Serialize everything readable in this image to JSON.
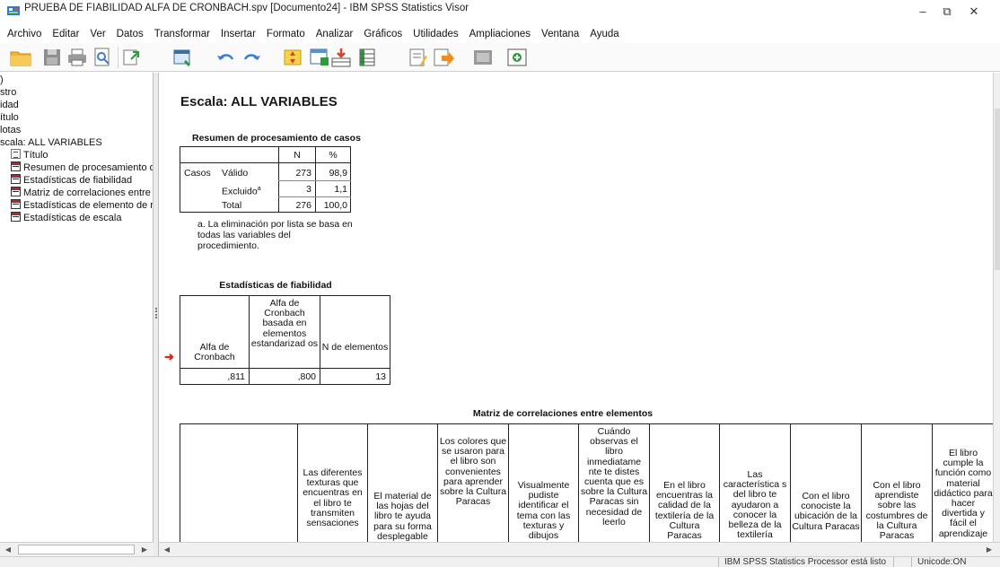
{
  "window": {
    "title": "PRUEBA DE FIABILIDAD ALFA DE CRONBACH.spv [Documento24] - IBM SPSS Statistics Visor",
    "minimize": "–",
    "maximize": "⧉",
    "close": "✕"
  },
  "menu": [
    "Archivo",
    "Editar",
    "Ver",
    "Datos",
    "Transformar",
    "Insertar",
    "Formato",
    "Analizar",
    "Gráficos",
    "Utilidades",
    "Ampliaciones",
    "Ventana",
    "Ayuda"
  ],
  "toolbar_icons": [
    "open-icon",
    "save-icon",
    "print-icon",
    "print-preview-icon",
    "export-icon",
    "recall-dialog-icon",
    "undo-icon",
    "redo-icon",
    "goto-data-icon",
    "goto-case-icon",
    "goto-variable-icon",
    "variables-icon",
    "insert-text-icon",
    "insert-heading-icon",
    "designate-window-icon",
    "show-all-icon"
  ],
  "outline": [
    {
      "label": ")",
      "icon": ""
    },
    {
      "label": "stro",
      "icon": ""
    },
    {
      "label": "idad",
      "icon": ""
    },
    {
      "label": "ítulo",
      "icon": ""
    },
    {
      "label": "lotas",
      "icon": ""
    },
    {
      "label": "scala: ALL VARIABLES",
      "icon": ""
    },
    {
      "label": "Título",
      "icon": "title"
    },
    {
      "label": "Resumen de procesamiento de",
      "icon": "table"
    },
    {
      "label": "Estadísticas de fiabilidad",
      "icon": "table"
    },
    {
      "label": "Matriz de correlaciones entre ele",
      "icon": "table"
    },
    {
      "label": "Estadísticas de elemento de res",
      "icon": "table"
    },
    {
      "label": "Estadísticas de escala",
      "icon": "table"
    }
  ],
  "scale_title": "Escala: ALL VARIABLES",
  "case_summary": {
    "title": "Resumen de procesamiento de casos",
    "headers": [
      "N",
      "%"
    ],
    "row_group": "Casos",
    "rows": [
      {
        "label": "Válido",
        "n": "273",
        "pct": "98,9"
      },
      {
        "label": "Excluido",
        "sup": "a",
        "n": "3",
        "pct": "1,1"
      },
      {
        "label": "Total",
        "n": "276",
        "pct": "100,0"
      }
    ],
    "footnote": "a. La eliminación por lista se basa en todas las variables del procedimiento."
  },
  "reliability": {
    "title": "Estadísticas de fiabilidad",
    "headers": [
      "Alfa de Cronbach",
      "Alfa de Cronbach basada en elementos estandarizad os",
      "N de elementos"
    ],
    "values": [
      ",811",
      ",800",
      "13"
    ]
  },
  "correlation": {
    "title": "Matriz de correlaciones entre elementos",
    "columns": [
      "Las diferentes texturas que encuentras en el libro te transmiten sensaciones",
      "El material de las hojas del libro te ayuda para su forma desplegable",
      "Los colores que se usaron para el libro son convenientes para aprender sobre la Cultura Paracas",
      "Visualmente pudiste identificar el tema con las texturas y dibujos",
      "Cuándo observas el libro inmediatame nte te distes cuenta que es sobre la Cultura Paracas sin necesidad de leerlo",
      "En el libro encuentras la calidad de la textilería de la Cultura Paracas",
      "Las característica s del libro te ayudaron a conocer la belleza de la textilería",
      "Con el libro conociste la ubicación de la Cultura Paracas",
      "Con el libro aprendiste sobre las costumbres de la Cultura Paracas",
      "El libro cumple la función como material didáctico para hacer divertida y fácil el aprendizaje"
    ]
  },
  "status": {
    "processor": "IBM SPSS Statistics Processor está listo",
    "unicode": "Unicode:ON"
  }
}
